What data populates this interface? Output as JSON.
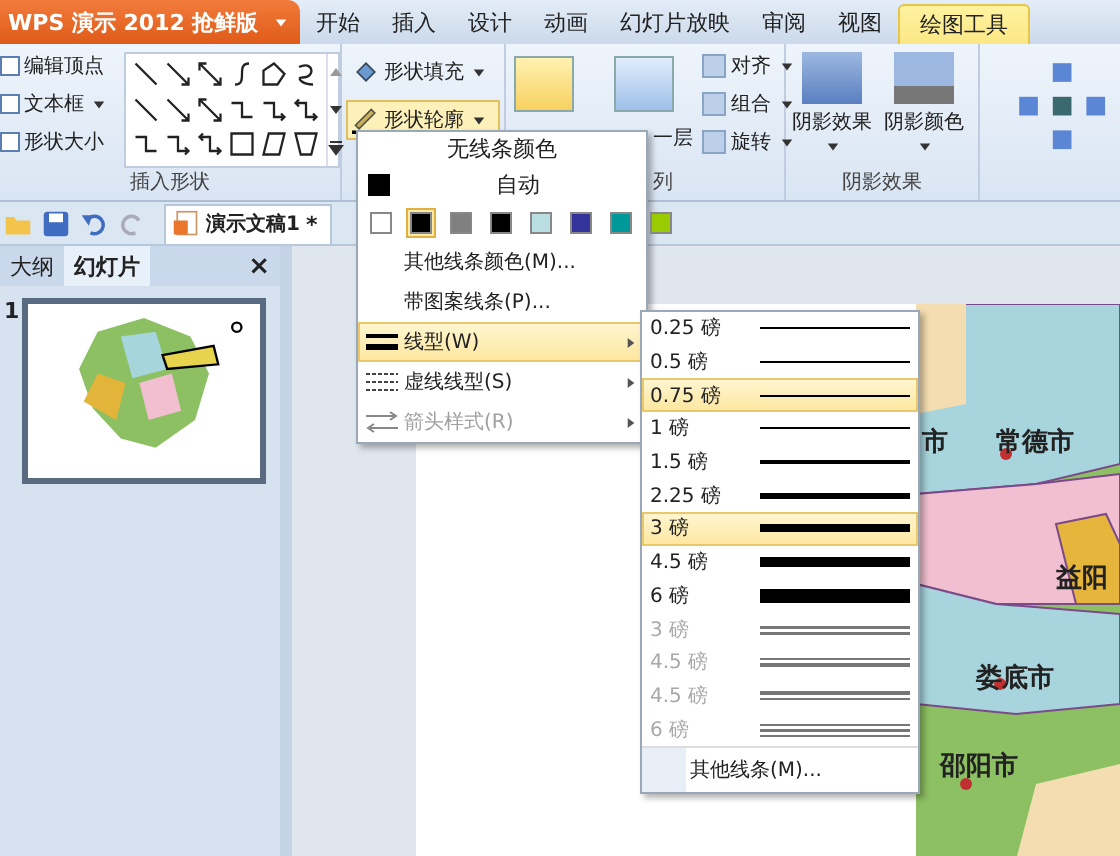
{
  "app_button": {
    "label": "WPS 演示 2012 抢鲜版"
  },
  "tabs": [
    {
      "label": "开始",
      "selected": false
    },
    {
      "label": "插入",
      "selected": false
    },
    {
      "label": "设计",
      "selected": false
    },
    {
      "label": "动画",
      "selected": false
    },
    {
      "label": "幻灯片放映",
      "selected": false
    },
    {
      "label": "审阅",
      "selected": false
    },
    {
      "label": "视图",
      "selected": false
    },
    {
      "label": "绘图工具",
      "selected": true
    }
  ],
  "ribbon": {
    "insert_shapes": {
      "commands": [
        {
          "label": "编辑顶点",
          "dropdown": false
        },
        {
          "label": "文本框",
          "dropdown": true
        },
        {
          "label": "形状大小",
          "dropdown": false
        }
      ],
      "group_label": "插入形状"
    },
    "shape_style": {
      "commands": [
        {
          "label": "形状填充",
          "active": false
        },
        {
          "label": "形状轮廓",
          "active": true
        }
      ]
    },
    "arrange": {
      "partial_label": "一层",
      "commands": [
        {
          "label": "对齐"
        },
        {
          "label": "组合"
        },
        {
          "label": "旋转"
        }
      ],
      "group_label": "列"
    },
    "shadow": {
      "commands": [
        {
          "label": "阴影效果"
        },
        {
          "label": "阴影颜色"
        }
      ],
      "group_label": "阴影效果"
    }
  },
  "document_tab": {
    "title": "演示文稿1",
    "modified": "*"
  },
  "side_pane": {
    "tabs": [
      {
        "label": "大纲",
        "selected": false
      },
      {
        "label": "幻灯片",
        "selected": true
      }
    ],
    "close": "×",
    "slides": [
      {
        "number": "1",
        "selected": true
      }
    ]
  },
  "slide": {
    "map_labels": [
      {
        "label": "市"
      },
      {
        "label": "常德市"
      },
      {
        "label": "益阳"
      },
      {
        "label": "娄底市"
      },
      {
        "label": "邵阳市"
      }
    ]
  },
  "outline_menu": {
    "no_color": "无线条颜色",
    "auto": "自动",
    "swatches": [
      {
        "color": "#ffffff",
        "selected": false
      },
      {
        "color": "#000000",
        "selected": true
      },
      {
        "color": "#808080",
        "selected": false
      },
      {
        "color": "#000000",
        "selected": false
      },
      {
        "color": "#b9dfe2",
        "selected": false
      },
      {
        "color": "#333399",
        "selected": false
      },
      {
        "color": "#009999",
        "selected": false
      },
      {
        "color": "#99cc00",
        "selected": false
      }
    ],
    "items": [
      {
        "label": "其他线条颜色(M)...",
        "kind": "plain",
        "submenu": false,
        "selected": false,
        "disabled": false
      },
      {
        "label": "带图案线条(P)...",
        "kind": "plain",
        "submenu": false,
        "selected": false,
        "disabled": false
      },
      {
        "label": "线型(W)",
        "kind": "weight",
        "submenu": true,
        "selected": true,
        "disabled": false
      },
      {
        "label": "虚线线型(S)",
        "kind": "dash",
        "submenu": true,
        "selected": false,
        "disabled": false
      },
      {
        "label": "箭头样式(R)",
        "kind": "arrow",
        "submenu": true,
        "selected": false,
        "disabled": true
      }
    ]
  },
  "weight_menu": {
    "items": [
      {
        "label": "0.25 磅",
        "kind": "single",
        "selected": false,
        "disabled": false
      },
      {
        "label": "0.5 磅",
        "kind": "single",
        "selected": false,
        "disabled": false
      },
      {
        "label": "0.75 磅",
        "kind": "single",
        "selected": true,
        "disabled": false
      },
      {
        "label": "1 磅",
        "kind": "single",
        "selected": false,
        "disabled": false
      },
      {
        "label": "1.5 磅",
        "kind": "single",
        "selected": false,
        "disabled": false
      },
      {
        "label": "2.25 磅",
        "kind": "single",
        "selected": false,
        "disabled": false
      },
      {
        "label": "3 磅",
        "kind": "single",
        "selected": true,
        "disabled": false
      },
      {
        "label": "4.5 磅",
        "kind": "single",
        "selected": false,
        "disabled": false
      },
      {
        "label": "6 磅",
        "kind": "single",
        "selected": false,
        "disabled": false
      },
      {
        "label": "3 磅",
        "kind": "double",
        "selected": false,
        "disabled": true
      },
      {
        "label": "4.5 磅",
        "kind": "thin-thick",
        "selected": false,
        "disabled": true
      },
      {
        "label": "4.5 磅",
        "kind": "thick-thin",
        "selected": false,
        "disabled": true
      },
      {
        "label": "6 磅",
        "kind": "triple",
        "selected": false,
        "disabled": true
      }
    ],
    "more": "其他线条(M)..."
  }
}
